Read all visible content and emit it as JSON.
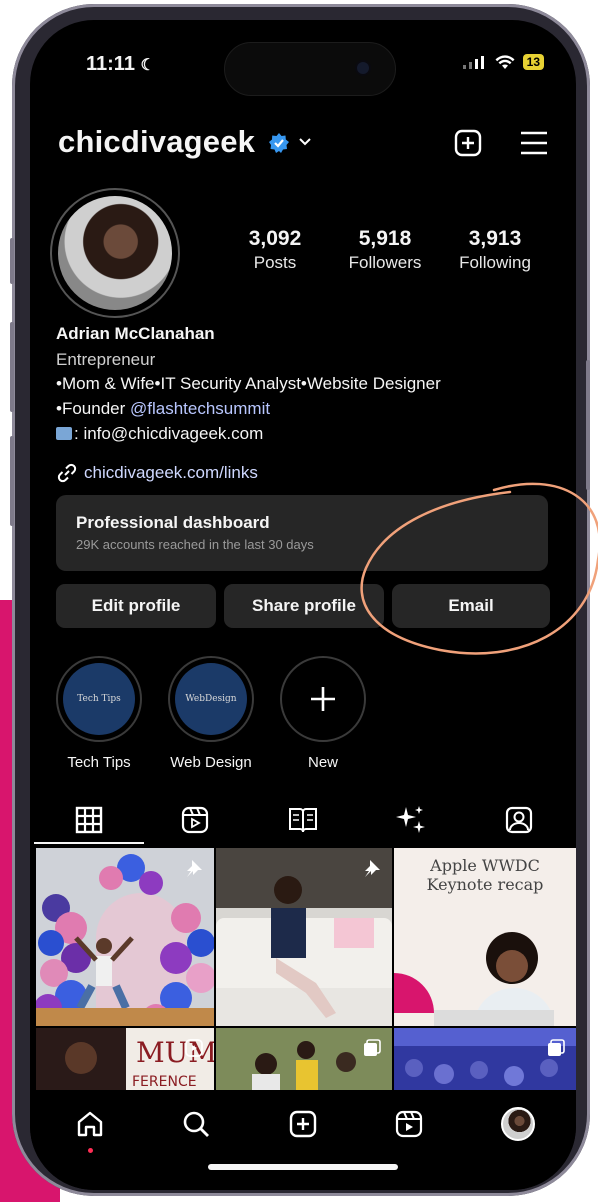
{
  "status_bar": {
    "time": "11:11",
    "battery": "13"
  },
  "header": {
    "username": "chicdivageek"
  },
  "stats": [
    {
      "value": "3,092",
      "label": "Posts"
    },
    {
      "value": "5,918",
      "label": "Followers"
    },
    {
      "value": "3,913",
      "label": "Following"
    }
  ],
  "bio": {
    "name": "Adrian McClanahan",
    "category": "Entrepreneur",
    "line1": "•Mom & Wife•IT Security Analyst•Website Designer",
    "line2_prefix": "•Founder ",
    "line2_mention": "@flashtechsummit",
    "line3": ": info@chicdivageek.com",
    "link": "chicdivageek.com/links"
  },
  "dashboard": {
    "title": "Professional dashboard",
    "subtitle": "29K accounts reached in the last 30 days"
  },
  "actions": {
    "edit": "Edit profile",
    "share": "Share profile",
    "email": "Email"
  },
  "highlights": [
    {
      "label": "Tech Tips",
      "cover_text": "Tech Tips"
    },
    {
      "label": "Web Design",
      "cover_text": "WebDesign"
    },
    {
      "label": "New"
    }
  ],
  "grid": {
    "post3_text": "Apple WWDC Keynote recap"
  },
  "colors": {
    "accent_pink": "#d8156d",
    "annotation": "#f0a17a",
    "verified": "#3797f0"
  }
}
